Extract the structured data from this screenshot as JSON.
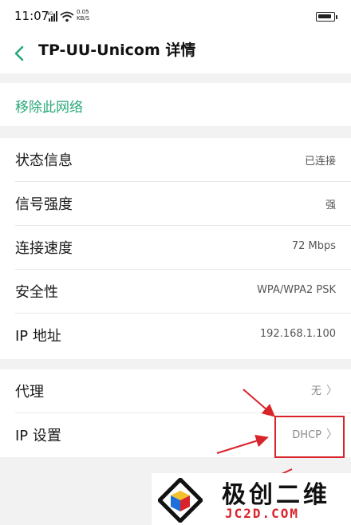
{
  "status_bar": {
    "time": "11:07",
    "net_type": "4G",
    "speed_value": "0.05",
    "speed_unit": "KB/S"
  },
  "header": {
    "title": "TP-UU-Unicom 详情"
  },
  "actions": {
    "remove_network": "移除此网络"
  },
  "info_rows": [
    {
      "label": "状态信息",
      "value": "已连接"
    },
    {
      "label": "信号强度",
      "value": "强"
    },
    {
      "label": "连接速度",
      "value": "72 Mbps"
    },
    {
      "label": "安全性",
      "value": "WPA/WPA2 PSK"
    },
    {
      "label": "IP 地址",
      "value": "192.168.1.100"
    }
  ],
  "setting_rows": [
    {
      "label": "代理",
      "value": "无"
    },
    {
      "label": "IP 设置",
      "value": "DHCP"
    }
  ],
  "watermark": {
    "title": "极创二维",
    "subtitle": "JC2D.COM"
  },
  "colors": {
    "accent_green": "#2aa87a",
    "annotation_red": "#d9232b"
  }
}
